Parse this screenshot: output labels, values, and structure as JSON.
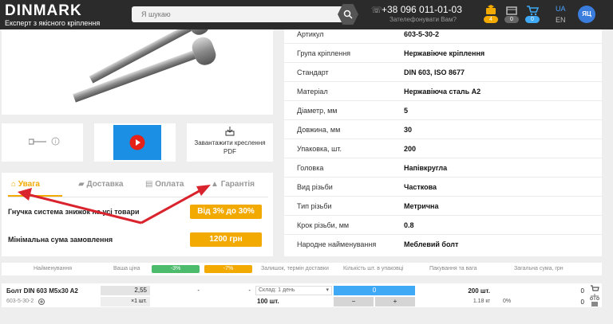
{
  "header": {
    "logo": "DINMARK",
    "tagline": "Експерт з якісного кріплення",
    "search_placeholder": "Я шукаю",
    "phone": "+38 096 011-01-03",
    "callback": "Зателефонувати Вам?",
    "badges": [
      "4",
      "0",
      "0"
    ],
    "lang_ua": "UA",
    "lang_en": "EN",
    "avatar": "ЯЦ"
  },
  "thumbnails": {
    "download_label": "Завантажити креслення PDF"
  },
  "specs": [
    {
      "label": "Артикул",
      "value": "603-5-30-2"
    },
    {
      "label": "Група кріплення",
      "value": "Нержавіюче кріплення"
    },
    {
      "label": "Стандарт",
      "value": "DIN 603, ISO 8677"
    },
    {
      "label": "Матеріал",
      "value": "Нержавіюча сталь А2"
    },
    {
      "label": "Діаметр, мм",
      "value": "5"
    },
    {
      "label": "Довжина, мм",
      "value": "30"
    },
    {
      "label": "Упаковка, шт.",
      "value": "200"
    },
    {
      "label": "Головка",
      "value": "Напівкругла"
    },
    {
      "label": "Вид різьби",
      "value": "Часткова"
    },
    {
      "label": "Тип різьби",
      "value": "Метрична"
    },
    {
      "label": "Крок різьби, мм",
      "value": "0.8"
    },
    {
      "label": "Народне найменування",
      "value": "Меблевий болт"
    }
  ],
  "tabs": [
    {
      "label": "Увага"
    },
    {
      "label": "Доставка"
    },
    {
      "label": "Оплата"
    },
    {
      "label": "Гарантія"
    }
  ],
  "promo": [
    {
      "text": "Гнучка система знижок на усі товари",
      "button": "Від 3% до 30%"
    },
    {
      "text": "Мінімальна сума замовлення",
      "button": "1200 грн"
    }
  ],
  "table_head": {
    "name": "Найменування",
    "price": "Ваша ціна",
    "disc1": "-3%",
    "disc2": "-7%",
    "stock": "Залишок, термін доставки",
    "qty": "Кількість шт. в упаковці",
    "pack": "Пакування та вага",
    "sum": "Загальна сума, грн"
  },
  "order_row": {
    "name": "Болт DIN 603 M5x30 A2",
    "sku": "603-5-30-2",
    "price": "2,55",
    "per": "×1 шт.",
    "d1": "-",
    "d2": "-",
    "warehouse": "Склад: 1 день",
    "stock_qty": "100 шт.",
    "qty": "0",
    "minus": "−",
    "plus": "+",
    "pack": "200 шт.",
    "weight": "1.18 кг",
    "pct": "0%",
    "sum": "0",
    "sum2": "0"
  },
  "colors": {
    "accent": "#f2a900",
    "header_bg": "#2b2b2b",
    "qty_blue": "#3fa9f5",
    "green": "#4cbb6c",
    "arrow": "#d9232d"
  }
}
